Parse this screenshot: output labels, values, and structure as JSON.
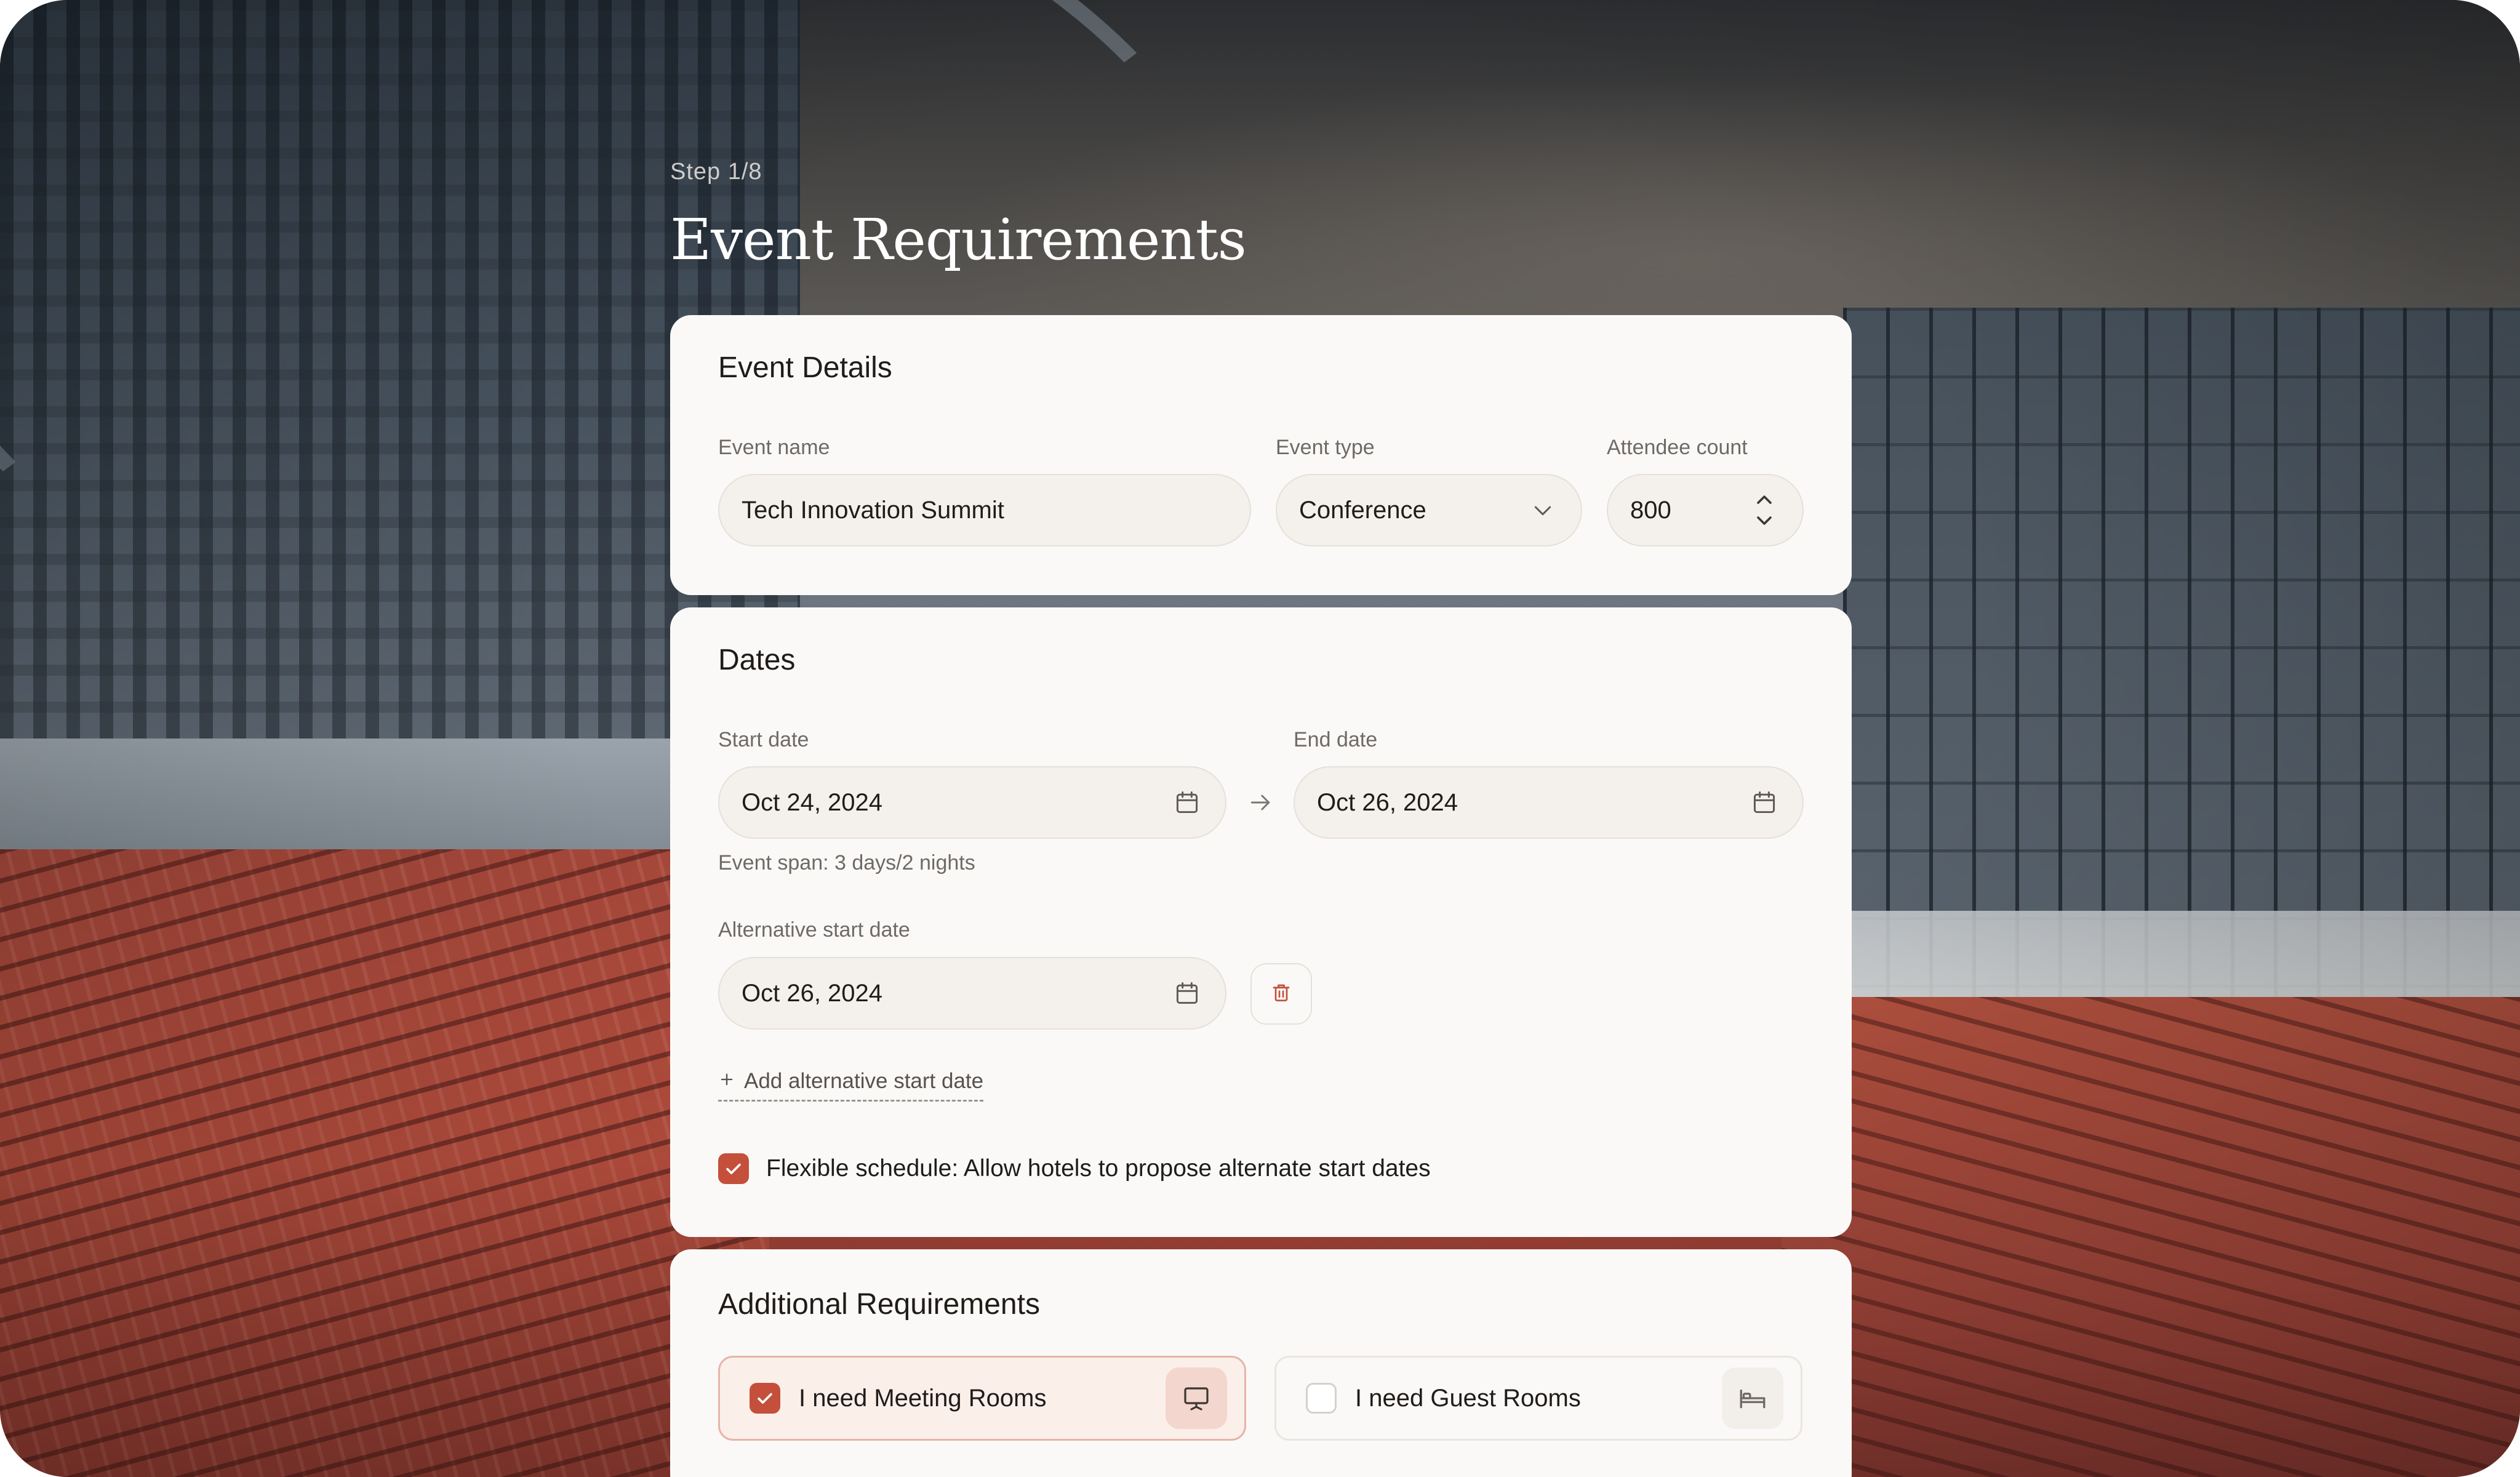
{
  "header": {
    "step": "Step 1/8",
    "title": "Event Requirements"
  },
  "event_details": {
    "title": "Event Details",
    "event_name": {
      "label": "Event name",
      "value": "Tech Innovation Summit"
    },
    "event_type": {
      "label": "Event type",
      "value": "Conference",
      "icon": "chevron-down-icon"
    },
    "attendee_count": {
      "label": "Attendee count",
      "value": "800",
      "icon": "stepper-icon"
    }
  },
  "dates": {
    "title": "Dates",
    "start_date": {
      "label": "Start date",
      "value": "Oct 24, 2024",
      "icon": "calendar-icon"
    },
    "end_date": {
      "label": "End date",
      "value": "Oct 26, 2024",
      "icon": "calendar-icon"
    },
    "span_hint": "Event span: 3 days/2 nights",
    "alternative_start": {
      "label": "Alternative start date",
      "value": "Oct 26, 2024",
      "icon": "calendar-icon"
    },
    "add_alternative": "Add alternative start date",
    "flexible": {
      "label": "Flexible schedule: Allow hotels to propose alternate start dates",
      "checked": true
    }
  },
  "additional": {
    "title": "Additional Requirements",
    "meeting_rooms": {
      "label": "I need Meeting Rooms",
      "checked": true,
      "icon": "presentation-board-icon"
    },
    "guest_rooms": {
      "label": "I need Guest Rooms",
      "checked": false,
      "icon": "bed-icon"
    }
  },
  "colors": {
    "accent": "#c4503c",
    "card": "#fbf9f7",
    "input_bg": "#f4f0ec",
    "text": "#1f1c1a",
    "muted": "#6f6a66"
  }
}
